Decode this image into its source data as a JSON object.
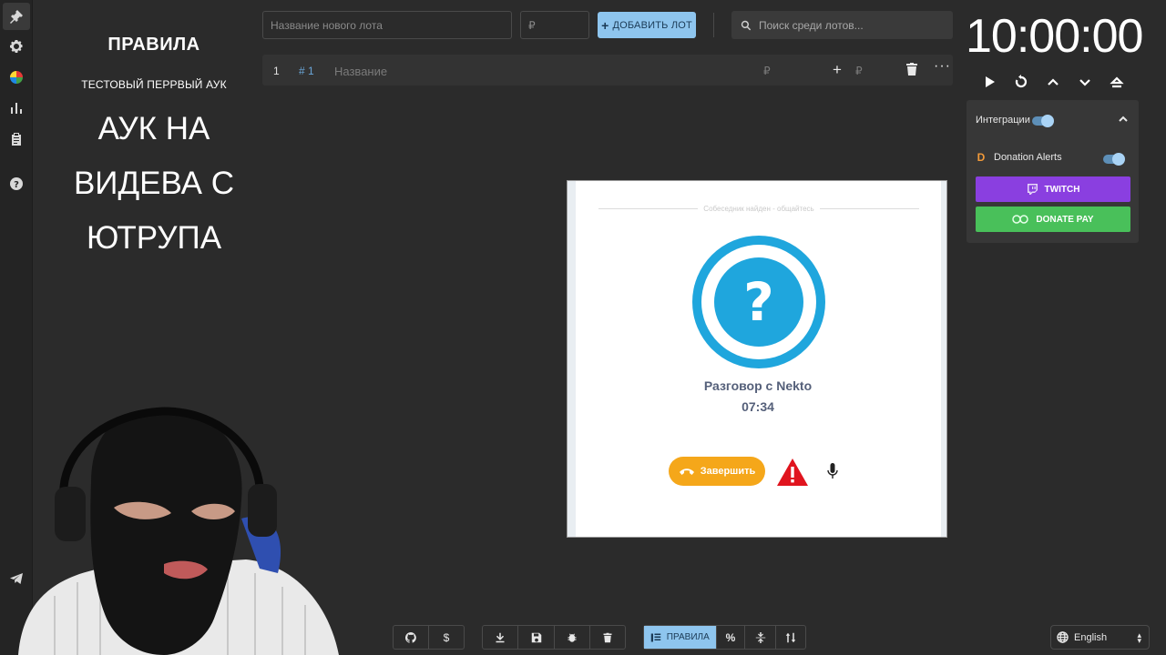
{
  "rail": {
    "icons": [
      "gavel-icon",
      "gear-icon",
      "pie-chart-icon",
      "bar-chart-icon",
      "clipboard-icon",
      "help-icon",
      "telegram-icon"
    ]
  },
  "rules": {
    "title": "ПРАВИЛА",
    "subtitle": "ТЕСТОВЫЙ ПЕРРВЫЙ АУК",
    "body": "АУК НА ВИДЕВА С ЮТРУПА"
  },
  "lot_form": {
    "name_placeholder": "Название нового лота",
    "amount_placeholder": "₽",
    "add_label": "ДОБАВИТЬ ЛОТ",
    "search_placeholder": "Поиск среди лотов..."
  },
  "lots": [
    {
      "index": "1",
      "tag": "# 1",
      "name": "Название",
      "amount_currency": "₽",
      "add_currency": "₽"
    }
  ],
  "timer": {
    "value": "10:00:00"
  },
  "integrations": {
    "header": "Интеграции",
    "donation_alerts": "Donation Alerts",
    "twitch": "TWITCH",
    "donatepay": "DONATE PAY"
  },
  "nekto": {
    "found_text": "Собеседник найден - общайтесь",
    "conversation": "Разговор с Nekto",
    "duration": "07:34",
    "end_label": "Завершить",
    "brand_colors": {
      "avatar": "#1fa6dd",
      "end": "#f5a71a",
      "warn": "#e0141e"
    }
  },
  "bottom": {
    "rules_label": "ПРАВИЛА",
    "percent_label": "%",
    "dollar_label": "$"
  },
  "language": {
    "selected": "English"
  }
}
